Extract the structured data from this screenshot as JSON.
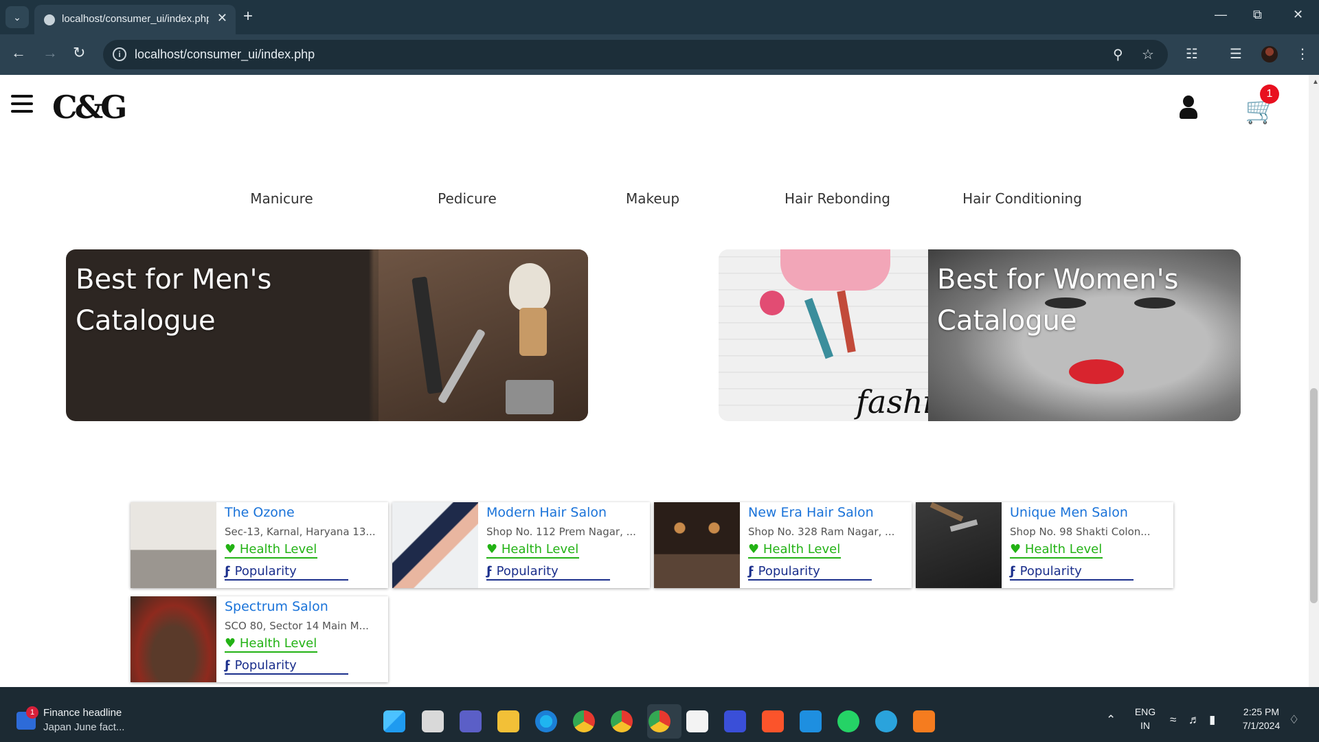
{
  "browser": {
    "tab_title": "localhost/consumer_ui/index.php",
    "url": "localhost/consumer_ui/index.php"
  },
  "site": {
    "logo_text": "C&G",
    "cart_count": "1"
  },
  "services": [
    {
      "label": "Manicure"
    },
    {
      "label": "Pedicure"
    },
    {
      "label": "Makeup"
    },
    {
      "label": "Hair Rebonding"
    },
    {
      "label": "Hair Conditioning"
    }
  ],
  "banners": {
    "men": {
      "line1": "Best for Men's",
      "line2": "Catalogue"
    },
    "women": {
      "line1": "Best for Women's",
      "line2": "Catalogue"
    }
  },
  "salon_labels": {
    "health": "Health Level",
    "popularity": "Popularity"
  },
  "salons": [
    {
      "name": "The Ozone",
      "address": "Sec-13, Karnal, Haryana 13..."
    },
    {
      "name": "Modern Hair Salon",
      "address": "Shop No. 112 Prem Nagar, ..."
    },
    {
      "name": "New Era Hair Salon",
      "address": "Shop No. 328 Ram Nagar, ..."
    },
    {
      "name": "Unique Men Salon",
      "address": "Shop No. 98 Shakti Colon..."
    },
    {
      "name": "Spectrum Salon",
      "address": "SCO 80, Sector 14 Main M..."
    }
  ],
  "taskbar": {
    "news_title": "Finance headline",
    "news_sub": "Japan June fact...",
    "news_badge": "1",
    "lang_line1": "ENG",
    "lang_line2": "IN",
    "time": "2:25 PM",
    "date": "7/1/2024"
  },
  "colors": {
    "chrome_dark": "#1f3441",
    "link_blue": "#1a73d9",
    "health_green": "#22b214",
    "popularity_navy": "#1b2f8c",
    "cart_badge_red": "#e8101f"
  }
}
